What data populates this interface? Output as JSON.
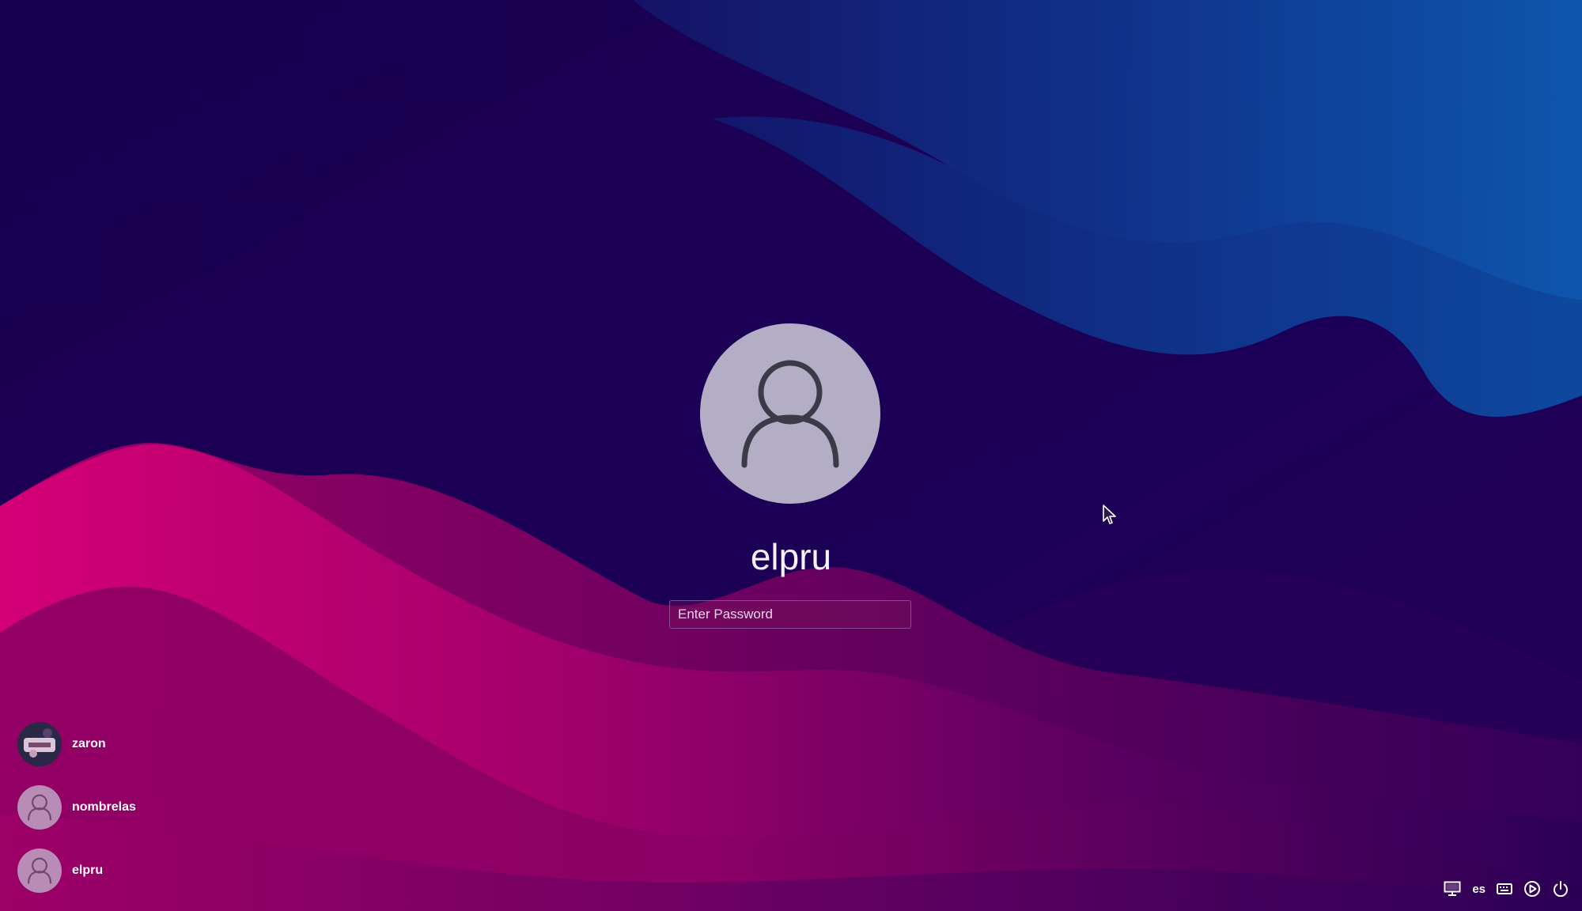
{
  "login": {
    "username": "elpru",
    "password_placeholder": "Enter Password",
    "avatar_icon": "user-icon"
  },
  "users": [
    {
      "name": "zaron",
      "avatar": "photo"
    },
    {
      "name": "nombrelas",
      "avatar": "user-icon"
    },
    {
      "name": "elpru",
      "avatar": "user-icon"
    }
  ],
  "tray": {
    "display_icon": "monitor-icon",
    "language": "es",
    "keyboard_icon": "keyboard-icon",
    "session_icon": "play-circle-icon",
    "power_icon": "power-icon"
  },
  "colors": {
    "background": "#1b0055",
    "wave_blue": "#0d5bb0",
    "wave_magenta": "#c8006e",
    "avatar_gray": "#b3adc6",
    "avatar_pink": "#b98cb8"
  }
}
